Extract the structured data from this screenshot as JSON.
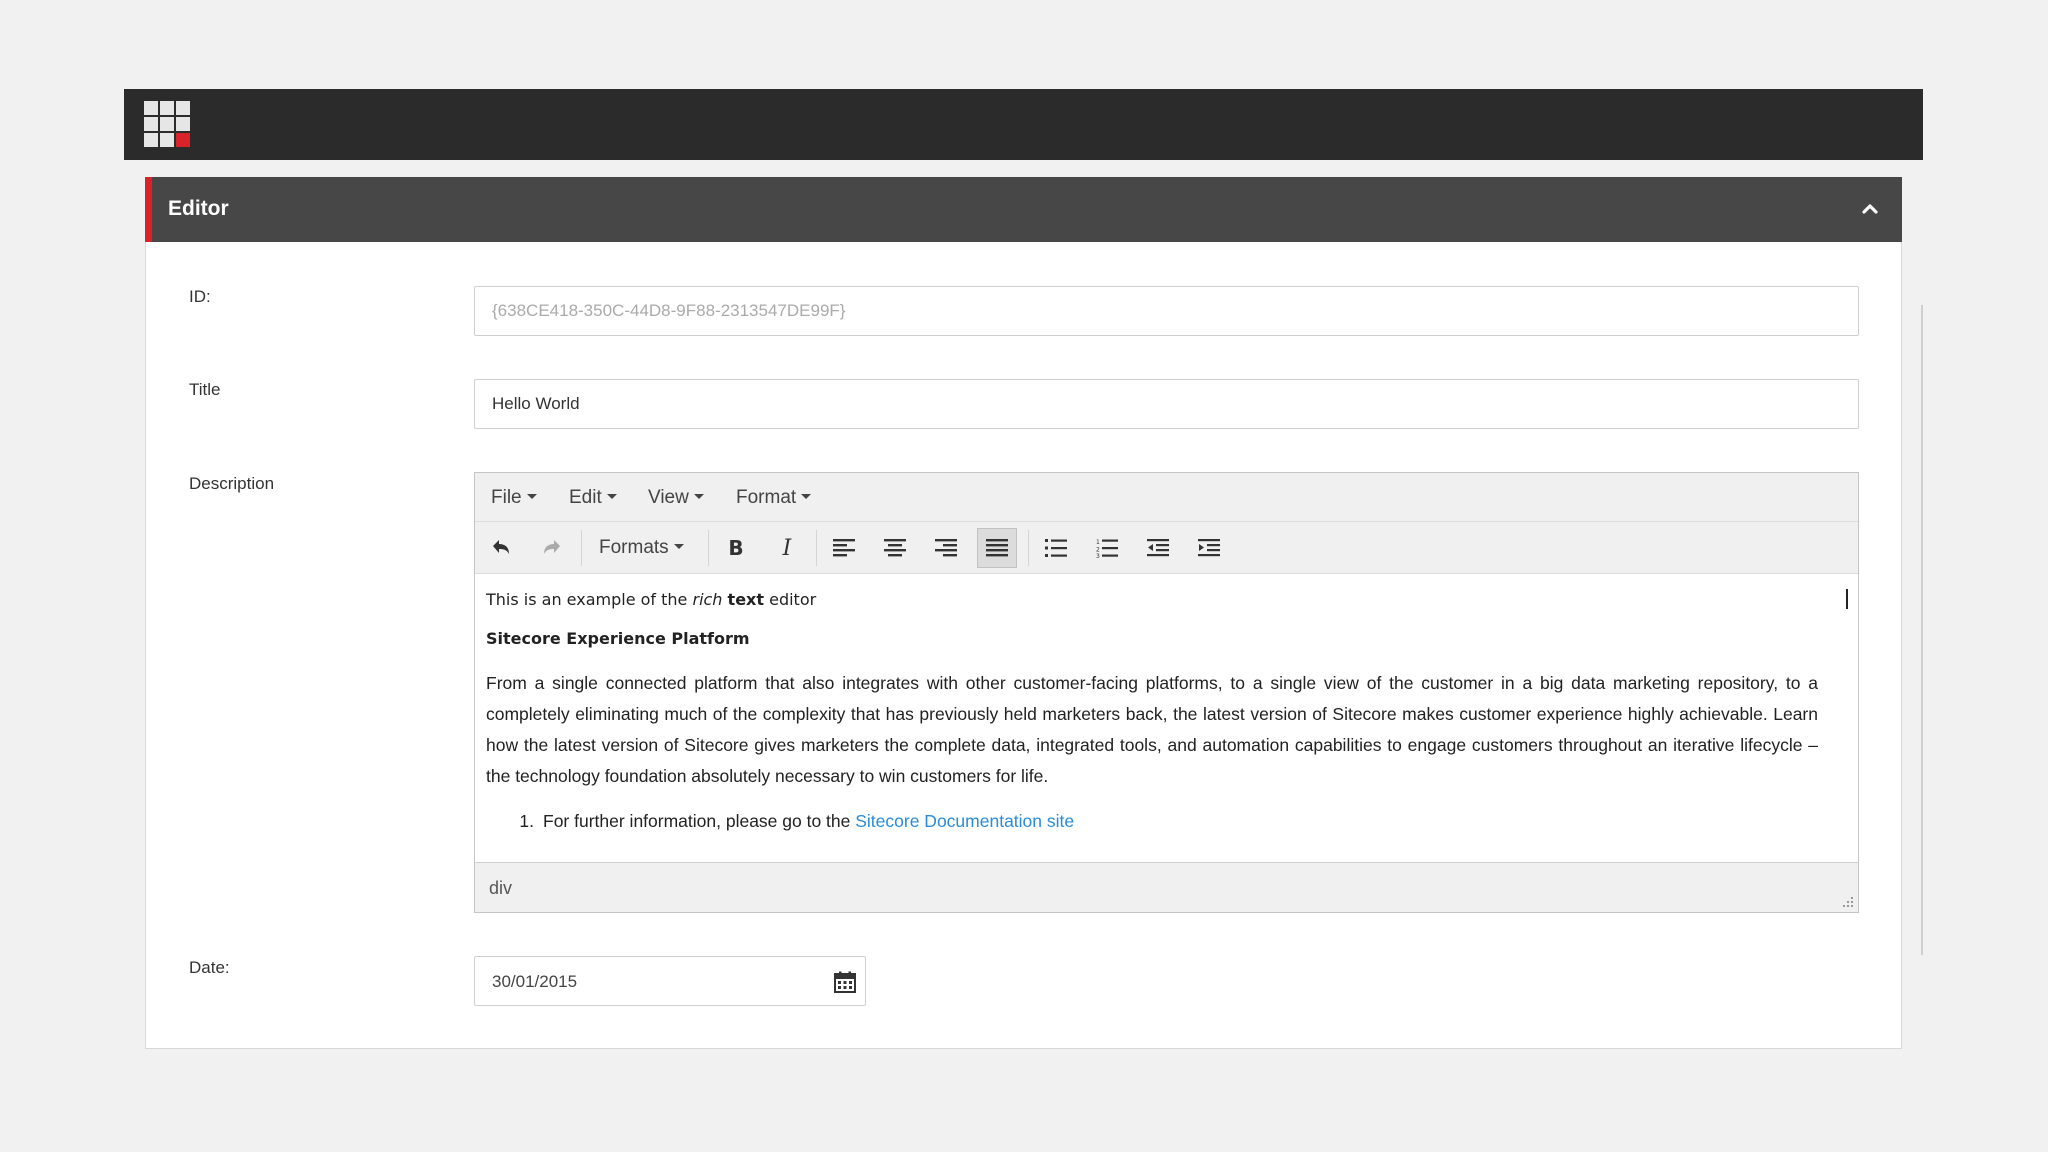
{
  "topbar": {
    "logo_icon": "launchpad-grid-icon",
    "accent": "#d9222a"
  },
  "panel": {
    "title": "Editor",
    "collapse_icon": "chevron-up-icon"
  },
  "fields": {
    "id_label": "ID:",
    "id_value": "{638CE418-350C-44D8-9F88-2313547DE99F}",
    "title_label": "Title",
    "title_value": "Hello World",
    "description_label": "Description",
    "date_label": "Date:",
    "date_value": "30/01/2015"
  },
  "editor": {
    "menu": [
      "File",
      "Edit",
      "View",
      "Format"
    ],
    "toolbar": {
      "formats_label": "Formats",
      "buttons": [
        "undo-icon",
        "redo-icon",
        "bold-icon",
        "italic-icon",
        "align-left-icon",
        "align-center-icon",
        "align-right-icon",
        "align-justify-icon",
        "bullet-list-icon",
        "numbered-list-icon",
        "outdent-icon",
        "indent-icon"
      ],
      "active_button": "align-justify-icon"
    },
    "content": {
      "line1_pre": "This is an example of the ",
      "line1_italic": "rich",
      "line1_space": " ",
      "line1_bold": "text",
      "line1_post": " editor",
      "heading": "Sitecore Experience Platform",
      "paragraph": "From a single connected platform that also integrates with other customer-facing platforms, to a single view of the customer in a big data marketing repository, to a completely eliminating much of the complexity that has previously held marketers back, the latest version of Sitecore makes customer experience highly achievable. Learn how the latest version of Sitecore gives marketers the complete data, integrated tools, and automation capabilities to engage customers throughout an iterative lifecycle – the technology foundation absolutely necessary to win customers for life.",
      "list_number": "1.",
      "list_text": "For further information, please go to the ",
      "list_link": "Sitecore Documentation site"
    },
    "status_path": "div"
  }
}
